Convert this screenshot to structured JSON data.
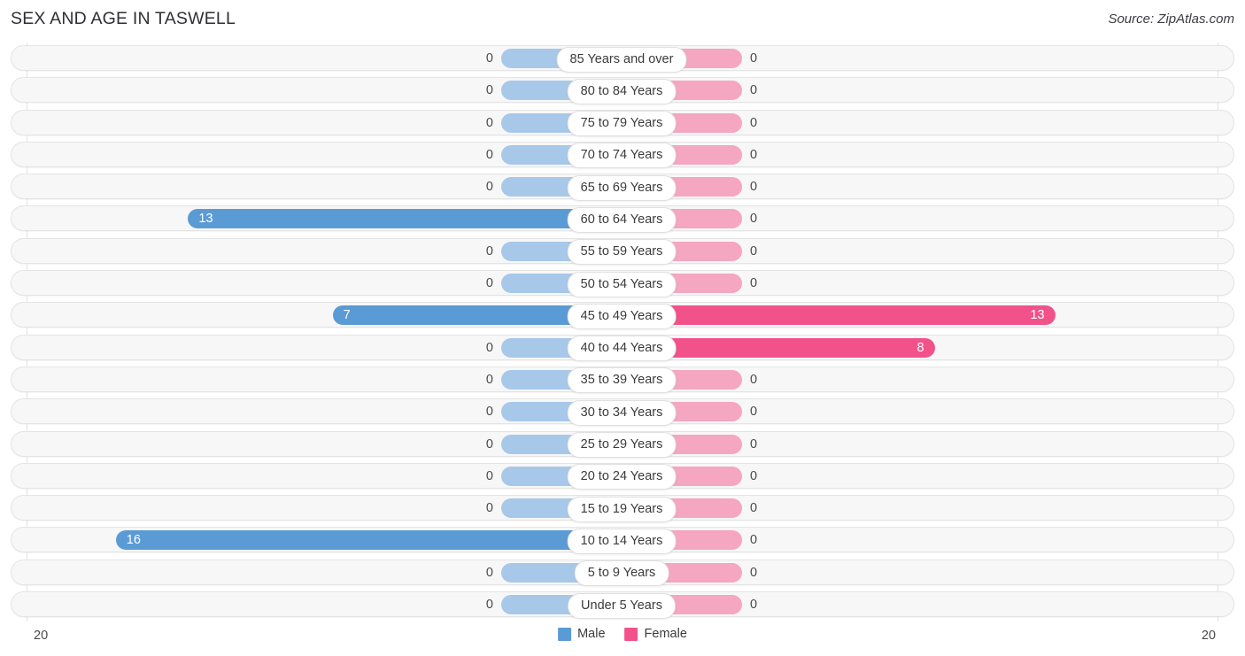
{
  "header": {
    "title": "SEX AND AGE IN TASWELL",
    "source": "Source: ZipAtlas.com"
  },
  "footer": {
    "axis_left": "20",
    "axis_right": "20",
    "legend": [
      {
        "label": "Male",
        "color": "#5b9bd5",
        "icon": "male-swatch"
      },
      {
        "label": "Female",
        "color": "#f2528a",
        "icon": "female-swatch"
      }
    ]
  },
  "chart_data": {
    "type": "bar",
    "subtype": "population-pyramid",
    "title": "SEX AND AGE IN TASWELL",
    "xlabel": "",
    "ylabel": "",
    "xlim": [
      20,
      20
    ],
    "axis_max": 20,
    "grid": true,
    "legend_position": "bottom-center",
    "categories": [
      "85 Years and over",
      "80 to 84 Years",
      "75 to 79 Years",
      "70 to 74 Years",
      "65 to 69 Years",
      "60 to 64 Years",
      "55 to 59 Years",
      "50 to 54 Years",
      "45 to 49 Years",
      "40 to 44 Years",
      "35 to 39 Years",
      "30 to 34 Years",
      "25 to 29 Years",
      "20 to 24 Years",
      "15 to 19 Years",
      "10 to 14 Years",
      "5 to 9 Years",
      "Under 5 Years"
    ],
    "series": [
      {
        "name": "Male",
        "color": "#5b9bd5",
        "muted_color": "#a8c8ea",
        "values": [
          0,
          0,
          0,
          0,
          0,
          13,
          0,
          0,
          7,
          0,
          0,
          0,
          0,
          0,
          0,
          16,
          0,
          0
        ]
      },
      {
        "name": "Female",
        "color": "#f2528a",
        "muted_color": "#f5a6c0",
        "values": [
          0,
          0,
          0,
          0,
          0,
          0,
          0,
          0,
          13,
          8,
          0,
          0,
          0,
          0,
          0,
          0,
          0,
          0
        ]
      }
    ]
  }
}
